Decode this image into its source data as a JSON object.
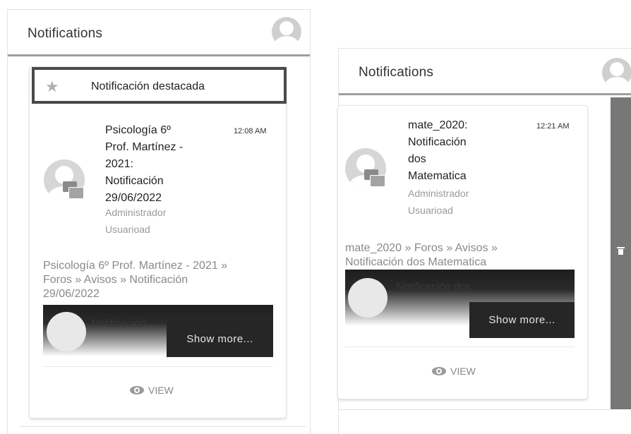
{
  "left_panel": {
    "title": "Notifications",
    "featured_label": "Notificación destacada",
    "notification": {
      "subject_lines": [
        "Psicología 6º",
        "Prof. Martínez -",
        "2021:",
        "Notificación",
        "29/06/2022"
      ],
      "time": "12:08 AM",
      "author_lines": [
        "Administrador",
        "Usuarioad"
      ],
      "path_lines": [
        "Psicología 6º Prof. Martínez - 2021 »",
        "Foros » Avisos » Notificación",
        "29/06/2022"
      ],
      "preview_text": "Notificación",
      "show_more": "Show more...",
      "view": "VIEW"
    }
  },
  "right_panel": {
    "title": "Notifications",
    "notification": {
      "subject_lines": [
        "mate_2020:",
        "Notificación",
        "dos",
        "Matematica"
      ],
      "time": "12:21 AM",
      "author_lines": [
        "Administrador",
        "Usuarioad"
      ],
      "path_lines": [
        "mate_2020 » Foros » Avisos »",
        "Notificación dos Matematica"
      ],
      "preview_text": "Notificación dos",
      "show_more": "Show more...",
      "view": "VIEW"
    },
    "side_action_icon": "trash-icon"
  },
  "colors": {
    "header_border": "#9e9e9e",
    "featured_border": "#4a4a4a",
    "show_more_bg": "#262626",
    "side_strip": "#777777"
  }
}
